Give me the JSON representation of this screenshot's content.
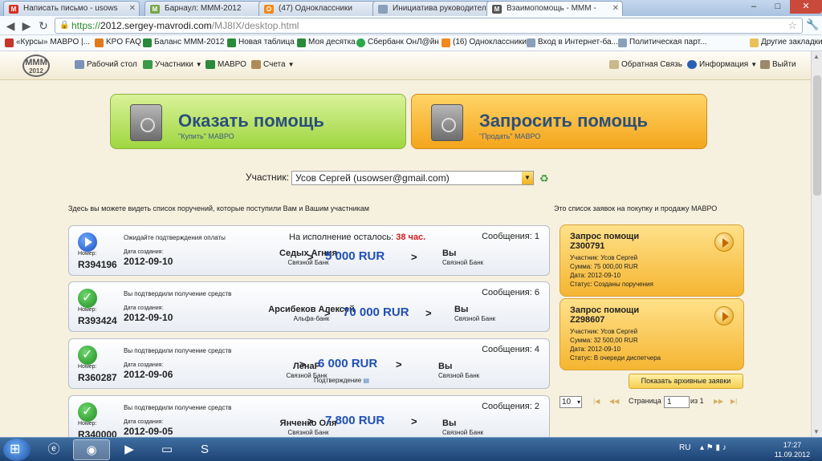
{
  "browser": {
    "tabs": [
      {
        "label": "Написать письмо - usows",
        "icon": "gmail-icon",
        "color": "#d93025",
        "glyph": "M"
      },
      {
        "label": "Барнаул: МММ-2012",
        "icon": "mmm-favicon-icon",
        "color": "#7aa64a",
        "glyph": "M"
      },
      {
        "label": "(47) Одноклассники",
        "icon": "odnoklassniki-icon",
        "color": "#f28a1b",
        "glyph": "O"
      },
      {
        "label": "Инициатива руководител",
        "icon": "page-icon",
        "color": "#8aa0b8",
        "glyph": ""
      },
      {
        "label": "Взаимопомощь - МММ -",
        "icon": "mmm-favicon-icon",
        "color": "#555555",
        "glyph": "M"
      }
    ],
    "url_scheme": "https://",
    "url_host": "2012.sergey-mavrodi.com",
    "url_path": "/MJ8IX/desktop.html",
    "bookmarks": [
      {
        "label": "«Курсы» МАВРО |...",
        "color": "#c8332a"
      },
      {
        "label": "KPO FAQ",
        "color": "#e07a1b"
      },
      {
        "label": "Баланс МММ-2012",
        "color": "#2a8a3a"
      },
      {
        "label": "Новая таблица",
        "color": "#2a8a3a"
      },
      {
        "label": "Моя десятка",
        "color": "#2a8a3a"
      },
      {
        "label": "Сбербанк ОнЛ@йн",
        "color": "#2aa84a"
      },
      {
        "label": "(16) Одноклассники",
        "color": "#f28a1b"
      },
      {
        "label": "Вход в Интернет-ба...",
        "color": "#8aa0b8"
      },
      {
        "label": "Политическая парт...",
        "color": "#8aa0b8"
      }
    ],
    "other_bookmarks": "Другие закладки"
  },
  "site": {
    "logo_text": "МММ",
    "logo_year": "2012",
    "menu": {
      "desktop": "Рабочий стол",
      "participants": "Участники",
      "mavro": "МАВРО",
      "accounts": "Счета",
      "feedback": "Обратная Связь",
      "info": "Информация",
      "logout": "Выйти"
    }
  },
  "main": {
    "give_title": "Оказать помощь",
    "give_sub": "\"Купить\" МАВРО",
    "ask_title": "Запросить помощь",
    "ask_sub": "\"Продать\" МАВРО",
    "participant_label": "Участник:",
    "participant_value": "Усов Сергей (usowser@gmail.com)",
    "left_caption": "Здесь вы можете видеть список поручений, которые поступили Вам и Вашим участникам",
    "right_caption": "Это список заявок на покупку и продажу МАВРО",
    "number_label": "Номер:",
    "date_label": "Дата создания:",
    "orders": [
      {
        "status": "Ожидайте подтверждения оплаты",
        "remaining_label": "На исполнение осталось:",
        "remaining_value": "38 час.",
        "messages": "Сообщения: 1",
        "number": "R394196",
        "date": "2012-09-10",
        "sender": "Седых Агния",
        "sender_bank": "Связной Банк",
        "amount": "5 000 RUR",
        "recipient": "Вы",
        "recipient_bank": "Связной Банк",
        "confirm": ""
      },
      {
        "status": "Вы подтвердили получение средств",
        "remaining_label": "",
        "remaining_value": "",
        "messages": "Сообщения: 6",
        "number": "R393424",
        "date": "2012-09-10",
        "sender": "Арсибеков Алексей",
        "sender_bank": "Альфа-банк",
        "amount": "70 000 RUR",
        "recipient": "Вы",
        "recipient_bank": "Связной Банк",
        "confirm": ""
      },
      {
        "status": "Вы подтвердили получение средств",
        "remaining_label": "",
        "remaining_value": "",
        "messages": "Сообщения: 4",
        "number": "R360287",
        "date": "2012-09-06",
        "sender": "ЛенаР",
        "sender_bank": "Связной Банк",
        "amount": "6 000 RUR",
        "recipient": "Вы",
        "recipient_bank": "Связной Банк",
        "confirm": "Подтверждение"
      },
      {
        "status": "Вы подтвердили получение средств",
        "remaining_label": "",
        "remaining_value": "",
        "messages": "Сообщения: 2",
        "number": "R340000",
        "date": "2012-09-05",
        "sender": "Янченко Оля",
        "sender_bank": "Связной Банк",
        "amount": "7 800 RUR",
        "recipient": "Вы",
        "recipient_bank": "Связной Банк",
        "confirm": ""
      }
    ],
    "requests": [
      {
        "title": "Запрос помощи",
        "id": "Z300791",
        "participant": "Участник: Усов Сергей",
        "sum": "Сумма: 75 000,00 RUR",
        "date": "Дата: 2012-09-10",
        "status": "Статус: Созданы поручения"
      },
      {
        "title": "Запрос помощи",
        "id": "Z298607",
        "participant": "Участник: Усов Сергей",
        "sum": "Сумма: 32 500,00 RUR",
        "date": "Дата: 2012-09-10",
        "status": "Статус: В очереди диспетчера"
      }
    ],
    "archive_button": "Показать архивные заявки",
    "pager": {
      "per_page": "10",
      "page_label": "Страница",
      "page_value": "1",
      "of_label": "из 1"
    }
  },
  "taskbar": {
    "lang": "RU",
    "time": "17:27",
    "date": "11.09.2012"
  }
}
